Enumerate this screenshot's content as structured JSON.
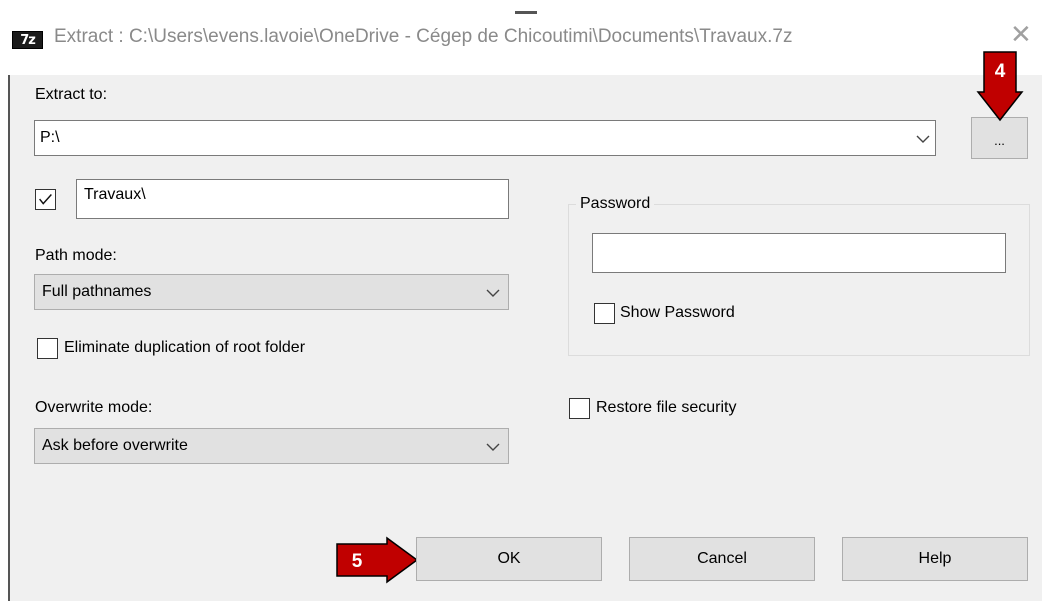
{
  "window": {
    "app_icon_label": "7z",
    "title": "Extract : C:\\Users\\evens.lavoie\\OneDrive - Cégep de Chicoutimi\\Documents\\Travaux.7z"
  },
  "extract_to": {
    "label": "Extract to:",
    "value": "P:\\",
    "browse_label": "..."
  },
  "subfolder": {
    "checked": true,
    "value": "Travaux\\"
  },
  "path_mode": {
    "label": "Path mode:",
    "selected": "Full pathnames"
  },
  "eliminate_duplication": {
    "label": "Eliminate duplication of root folder",
    "checked": false
  },
  "overwrite_mode": {
    "label": "Overwrite mode:",
    "selected": "Ask before overwrite"
  },
  "password": {
    "group_label": "Password",
    "value": "",
    "show_password_label": "Show Password",
    "show_password_checked": false
  },
  "restore_security": {
    "label": "Restore file security",
    "checked": false
  },
  "buttons": {
    "ok": "OK",
    "cancel": "Cancel",
    "help": "Help"
  },
  "annotations": {
    "marker_4": "4",
    "marker_5": "5",
    "marker_color": "#c00000"
  }
}
